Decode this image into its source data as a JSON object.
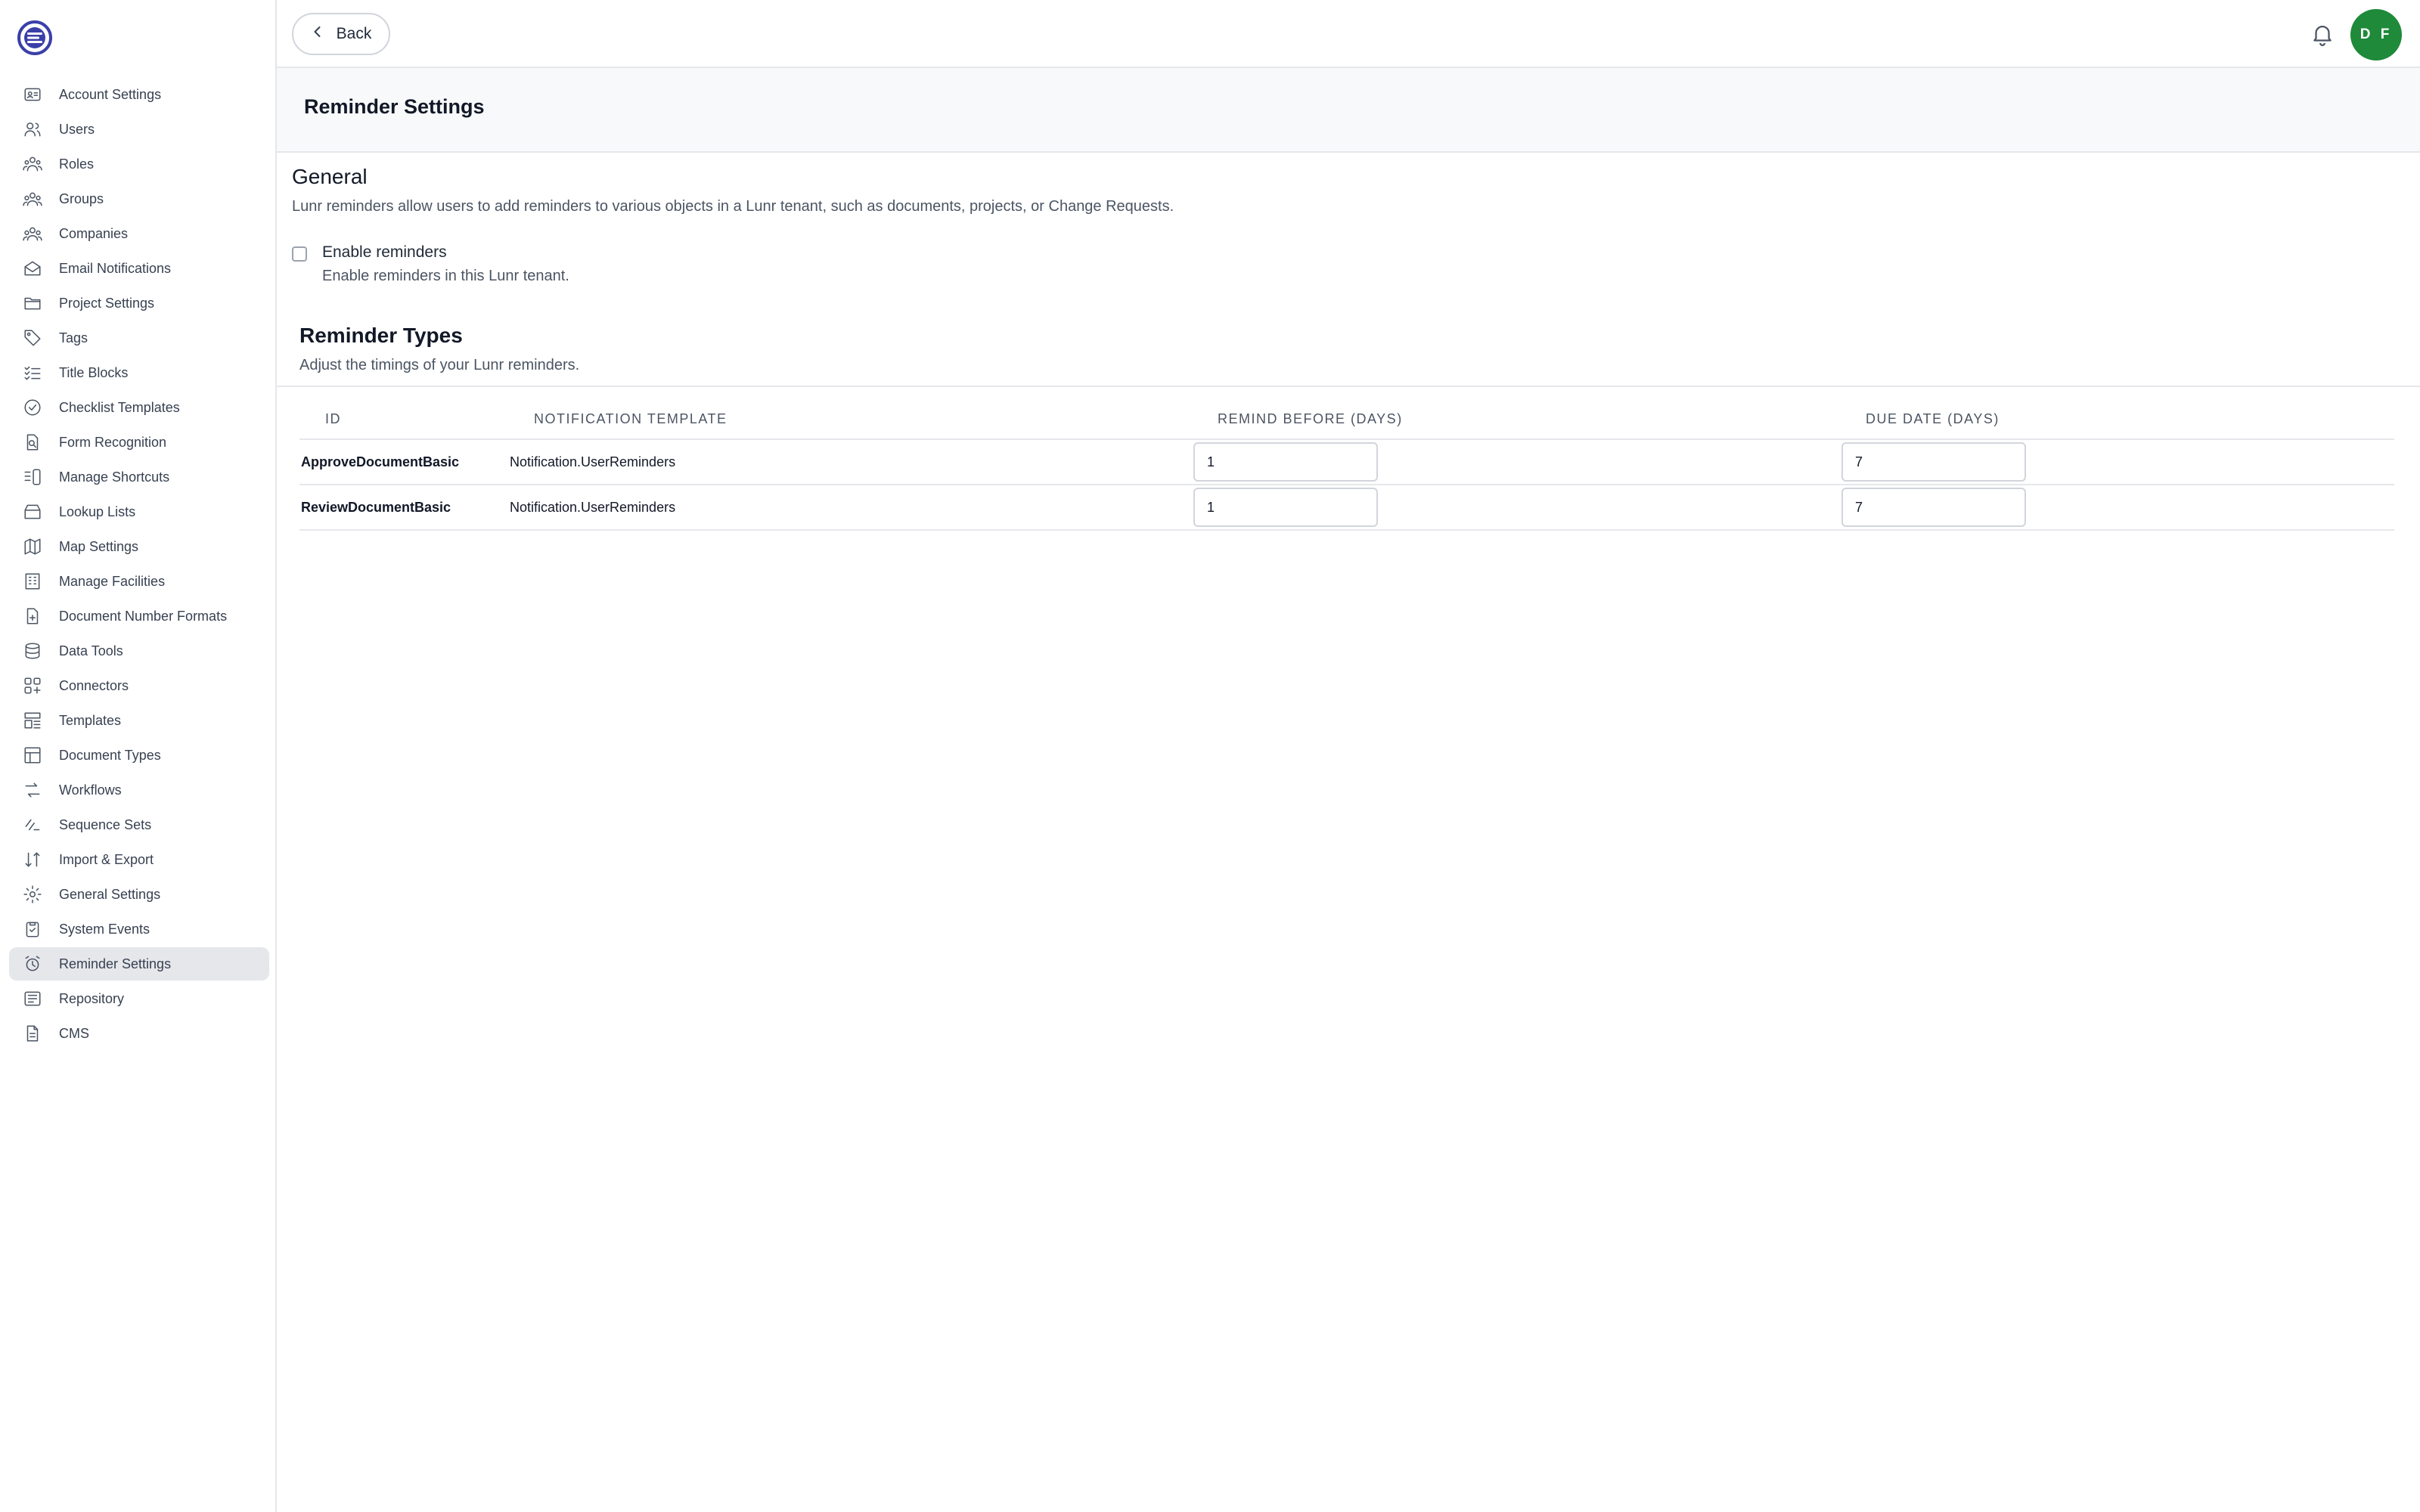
{
  "sidebar": {
    "items": [
      {
        "label": "Account Settings",
        "icon": "id-card-icon"
      },
      {
        "label": "Users",
        "icon": "users-icon"
      },
      {
        "label": "Roles",
        "icon": "roles-icon"
      },
      {
        "label": "Groups",
        "icon": "groups-icon"
      },
      {
        "label": "Companies",
        "icon": "companies-icon"
      },
      {
        "label": "Email Notifications",
        "icon": "mail-open-icon"
      },
      {
        "label": "Project Settings",
        "icon": "folder-icon"
      },
      {
        "label": "Tags",
        "icon": "tag-icon"
      },
      {
        "label": "Title Blocks",
        "icon": "list-checks-icon"
      },
      {
        "label": "Checklist Templates",
        "icon": "check-circle-icon"
      },
      {
        "label": "Form Recognition",
        "icon": "file-search-icon"
      },
      {
        "label": "Manage Shortcuts",
        "icon": "shortcut-icon"
      },
      {
        "label": "Lookup Lists",
        "icon": "archive-icon"
      },
      {
        "label": "Map Settings",
        "icon": "map-icon"
      },
      {
        "label": "Manage Facilities",
        "icon": "building-icon"
      },
      {
        "label": "Document Number Formats",
        "icon": "file-plus-icon"
      },
      {
        "label": "Data Tools",
        "icon": "database-icon"
      },
      {
        "label": "Connectors",
        "icon": "grid-plus-icon"
      },
      {
        "label": "Templates",
        "icon": "template-icon"
      },
      {
        "label": "Document Types",
        "icon": "layout-icon"
      },
      {
        "label": "Workflows",
        "icon": "workflow-icon"
      },
      {
        "label": "Sequence Sets",
        "icon": "sequence-icon"
      },
      {
        "label": "Import & Export",
        "icon": "arrows-updown-icon"
      },
      {
        "label": "General Settings",
        "icon": "gear-icon"
      },
      {
        "label": "System Events",
        "icon": "clipboard-check-icon"
      },
      {
        "label": "Reminder Settings",
        "icon": "alarm-clock-icon"
      },
      {
        "label": "Repository",
        "icon": "repository-icon"
      },
      {
        "label": "CMS",
        "icon": "document-icon"
      }
    ],
    "active_index": 25
  },
  "topbar": {
    "back_label": "Back",
    "avatar_initials": "D F"
  },
  "page": {
    "title": "Reminder Settings"
  },
  "general": {
    "title": "General",
    "description": "Lunr reminders allow users to add reminders to various objects in a Lunr tenant, such as documents, projects, or Change Requests.",
    "checkbox_label": "Enable reminders",
    "checkbox_help": "Enable reminders in this Lunr tenant.",
    "checkbox_checked": false
  },
  "reminder_types": {
    "title": "Reminder Types",
    "description": "Adjust the timings of your Lunr reminders.",
    "columns": [
      "ID",
      "Notification Template",
      "Remind Before (Days)",
      "Due Date (Days)"
    ],
    "rows": [
      {
        "id": "ApproveDocumentBasic",
        "template": "Notification.UserReminders",
        "remind_before": "1",
        "due_date": "7"
      },
      {
        "id": "ReviewDocumentBasic",
        "template": "Notification.UserReminders",
        "remind_before": "1",
        "due_date": "7"
      }
    ]
  },
  "colors": {
    "active_bg": "#e5e7eb",
    "avatar_bg": "#1e8a3a",
    "logo": "#3b3fa8"
  }
}
